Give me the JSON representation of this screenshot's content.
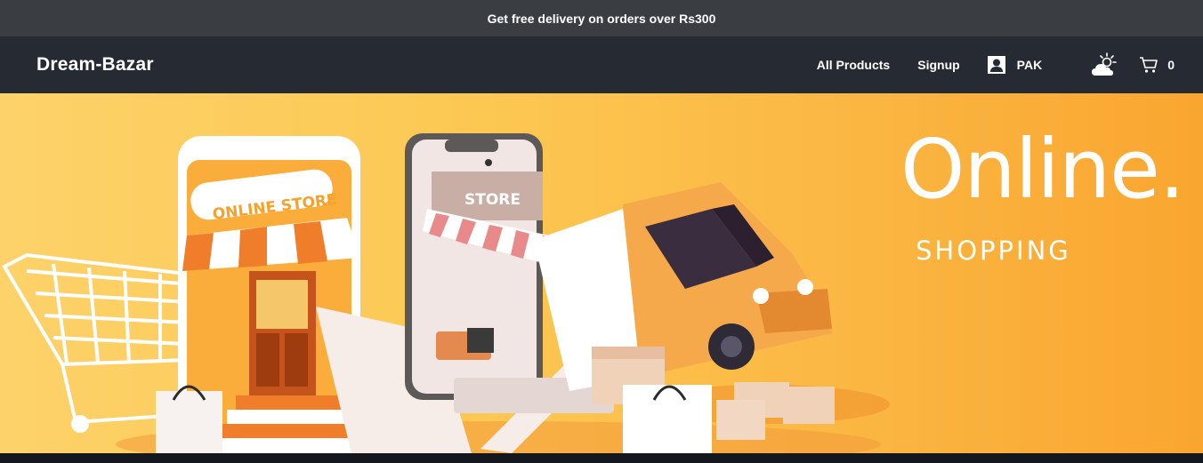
{
  "announcement": {
    "text": "Get free delivery on orders over Rs300"
  },
  "navbar": {
    "brand": "Dream-Bazar",
    "links": [
      {
        "label": "All Products"
      },
      {
        "label": "Signup"
      }
    ],
    "user": {
      "label": "PAK",
      "icon": "user-icon"
    },
    "weather": {
      "icon": "cloud-sun-icon"
    },
    "cart": {
      "icon": "cart-icon",
      "count": "0"
    }
  },
  "hero": {
    "title": "Online.",
    "subtitle": "SHOPPING",
    "illustration": {
      "store_sign": "ONLINE STORE",
      "phone_sign": "STORE"
    }
  },
  "colors": {
    "announcement_bg": "#3a3d42",
    "navbar_bg": "#262a33",
    "hero_gradient_start": "#fdd26a",
    "hero_gradient_end": "#f9a630",
    "accent_orange": "#f07d2a"
  }
}
